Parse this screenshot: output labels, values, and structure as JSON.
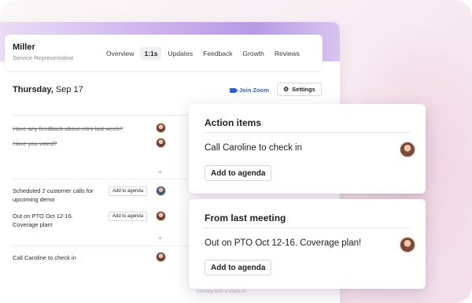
{
  "employee": {
    "name": "Miller",
    "role": "Service Representative"
  },
  "tabs": [
    "Overview",
    "1:1s",
    "Updates",
    "Feedback",
    "Growth",
    "Reviews"
  ],
  "active_tab": "1:1s",
  "meeting": {
    "date_bold": "Thursday,",
    "date_rest": " Sep 17",
    "join_label": "Join Zoom",
    "settings_label": "Settings"
  },
  "agenda": {
    "item1": "Have any feedback about retro last week?",
    "item2": "Have you voted?",
    "item3": "Scheduled 2 customer calls for upcoming demo",
    "item4": "Out on PTO Oct 12-16. Coverage plan!",
    "item5": "Call Caroline to check in",
    "add_label": "Add to agenda",
    "plus": "+"
  },
  "faded_text": "monday with a check-in",
  "action_card": {
    "title": "Action items",
    "item": "Call Caroline to check in",
    "button": "Add to agenda"
  },
  "last_card": {
    "title": "From last meeting",
    "item": "Out on PTO Oct 12-16. Coverage plan!",
    "button": "Add to agenda"
  },
  "colors": {
    "accent_blue": "#2b5fd9",
    "gradient_purple": "#b79ae6",
    "background_pink": "#f6e6ee"
  }
}
